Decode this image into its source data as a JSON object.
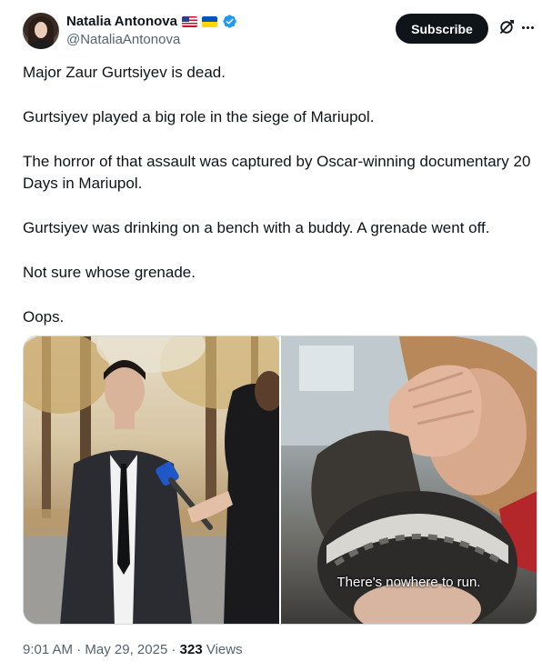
{
  "author": {
    "display_name": "Natalia Antonova",
    "handle": "@NataliaAntonova",
    "flags": [
      "us-flag",
      "ukraine-flag"
    ],
    "verified": true,
    "verified_color": "#1d9bf0"
  },
  "actions": {
    "subscribe_label": "Subscribe"
  },
  "tweet": {
    "paragraphs": [
      "Major Zaur Gurtsiyev is dead.",
      "Gurtsiyev played a big role in the siege of Mariupol.",
      "The horror of that assault was captured by Oscar-winning documentary 20 Days in Mariupol.",
      "Gurtsiyev was drinking on a bench with a buddy. A grenade went off.",
      "Not sure whose grenade.",
      "Oops."
    ]
  },
  "media": {
    "right_caption": "There's nowhere to run."
  },
  "meta": {
    "time": "9:01 AM",
    "separator": "·",
    "date": "May 29, 2025",
    "views_count": "323",
    "views_label": "Views"
  }
}
